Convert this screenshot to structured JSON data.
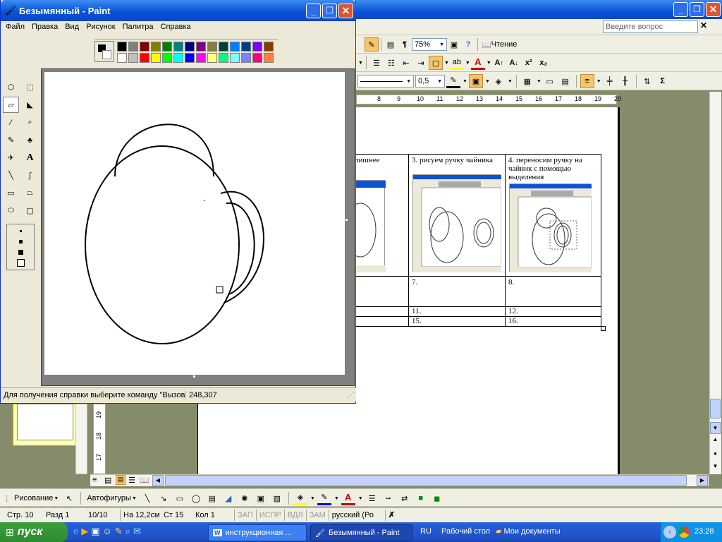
{
  "word": {
    "help_placeholder": "Введите вопрос",
    "zoom": "75%",
    "read_button": "Чтение",
    "line_width": "0,5",
    "ruler_numbers": [
      "8",
      "9",
      "10",
      "11",
      "12",
      "13",
      "14",
      "15",
      "16",
      "17",
      "18",
      "19",
      "20"
    ],
    "vruler_numbers": [
      "17",
      "18",
      "19"
    ],
    "table": {
      "headers": [
        "лишнее",
        "3.  рисуем ручку чайника",
        "4.  переносим ручку на чайник с помощью выделения"
      ],
      "row2": [
        "",
        "7.",
        "8."
      ],
      "row3": [
        "",
        "11.",
        "12."
      ],
      "row4": [
        "",
        "15.",
        "16."
      ]
    },
    "drawing_bar": {
      "draw": "Рисование",
      "autoshapes": "Автофигуры"
    },
    "status": {
      "page": "Стр.  10",
      "section": "Разд  1",
      "pages": "10/10",
      "at": "На 12,2см",
      "line": "Ст  15",
      "col": "Кол  1",
      "rec": "ЗАП",
      "trk": "ИСПР",
      "ext": "ВДЛ",
      "ovr": "ЗАМ",
      "lang": "русский (Ро"
    }
  },
  "paint": {
    "title": "Безымянный - Paint",
    "menu": [
      "Файл",
      "Правка",
      "Вид",
      "Рисунок",
      "Палитра",
      "Справка"
    ],
    "palette_top": [
      "#000000",
      "#808080",
      "#800000",
      "#808000",
      "#008000",
      "#008080",
      "#000080",
      "#800080",
      "#808040",
      "#004040",
      "#0080ff",
      "#004080",
      "#8000ff",
      "#804000"
    ],
    "palette_bottom": [
      "#ffffff",
      "#c0c0c0",
      "#ff0000",
      "#ffff00",
      "#00ff00",
      "#00ffff",
      "#0000ff",
      "#ff00ff",
      "#ffff80",
      "#00ff80",
      "#80ffff",
      "#8080ff",
      "#ff0080",
      "#ff8040"
    ],
    "tools": [
      "free-select-icon",
      "rect-select-icon",
      "eraser-icon",
      "fill-icon",
      "color-picker-icon",
      "magnifier-icon",
      "pencil-icon",
      "brush-icon",
      "airbrush-icon",
      "text-icon",
      "line-icon",
      "curve-icon",
      "rectangle-icon",
      "polygon-icon",
      "ellipse-icon",
      "rounded-rect-icon"
    ],
    "status_text": "Для получения справки выберите команду \"Вызов",
    "coords": "248,307"
  },
  "taskbar": {
    "start": "пуск",
    "tasks": [
      "инструкционная ...",
      "Безымянный - Paint"
    ],
    "lang": "RU",
    "desktop": "Рабочий стол",
    "mydocs": "Мои документы",
    "clock": "23:28"
  }
}
